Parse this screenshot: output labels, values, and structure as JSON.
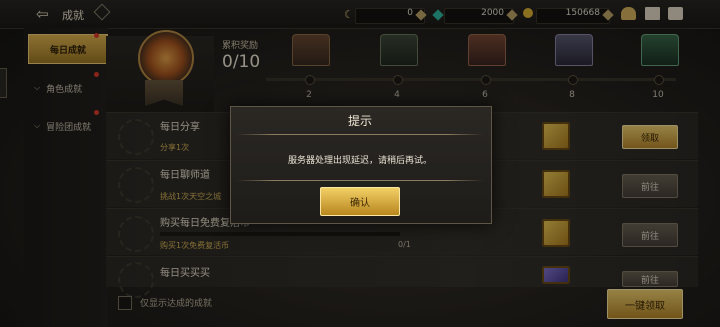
{
  "header": {
    "title": "成就"
  },
  "resources": [
    {
      "value": "0",
      "color": "#bfa76a"
    },
    {
      "value": "2000",
      "color": "#2fb8a0"
    },
    {
      "value": "150668",
      "color": "#e0b534"
    }
  ],
  "tabs": [
    {
      "label": "每日成就",
      "active": true
    },
    {
      "label": "角色成就",
      "active": false
    },
    {
      "label": "冒险团成就",
      "active": false
    }
  ],
  "reward": {
    "label": "累积奖励",
    "progress": "0/10",
    "milestones": [
      "2",
      "4",
      "6",
      "8",
      "10"
    ]
  },
  "rows": [
    {
      "title": "每日分享",
      "desc": "分享1次",
      "count": "",
      "button": "领取",
      "button_type": "claim"
    },
    {
      "title": "每日聊师道",
      "desc": "挑战1次天空之城",
      "count": "",
      "button": "前往",
      "button_type": "go"
    },
    {
      "title": "购买每日免费复活币",
      "desc": "购买1次免费复活币",
      "count": "0/1",
      "button": "前往",
      "button_type": "go"
    },
    {
      "title": "每日买买买",
      "desc": "",
      "count": "",
      "button": "前往",
      "button_type": "go"
    }
  ],
  "footer": {
    "checkbox_label": "仅显示达成的成就",
    "claim_all": "一键领取"
  },
  "dialog": {
    "title": "提示",
    "message": "服务器处理出现延迟，请稍后再试。",
    "ok": "确认"
  }
}
